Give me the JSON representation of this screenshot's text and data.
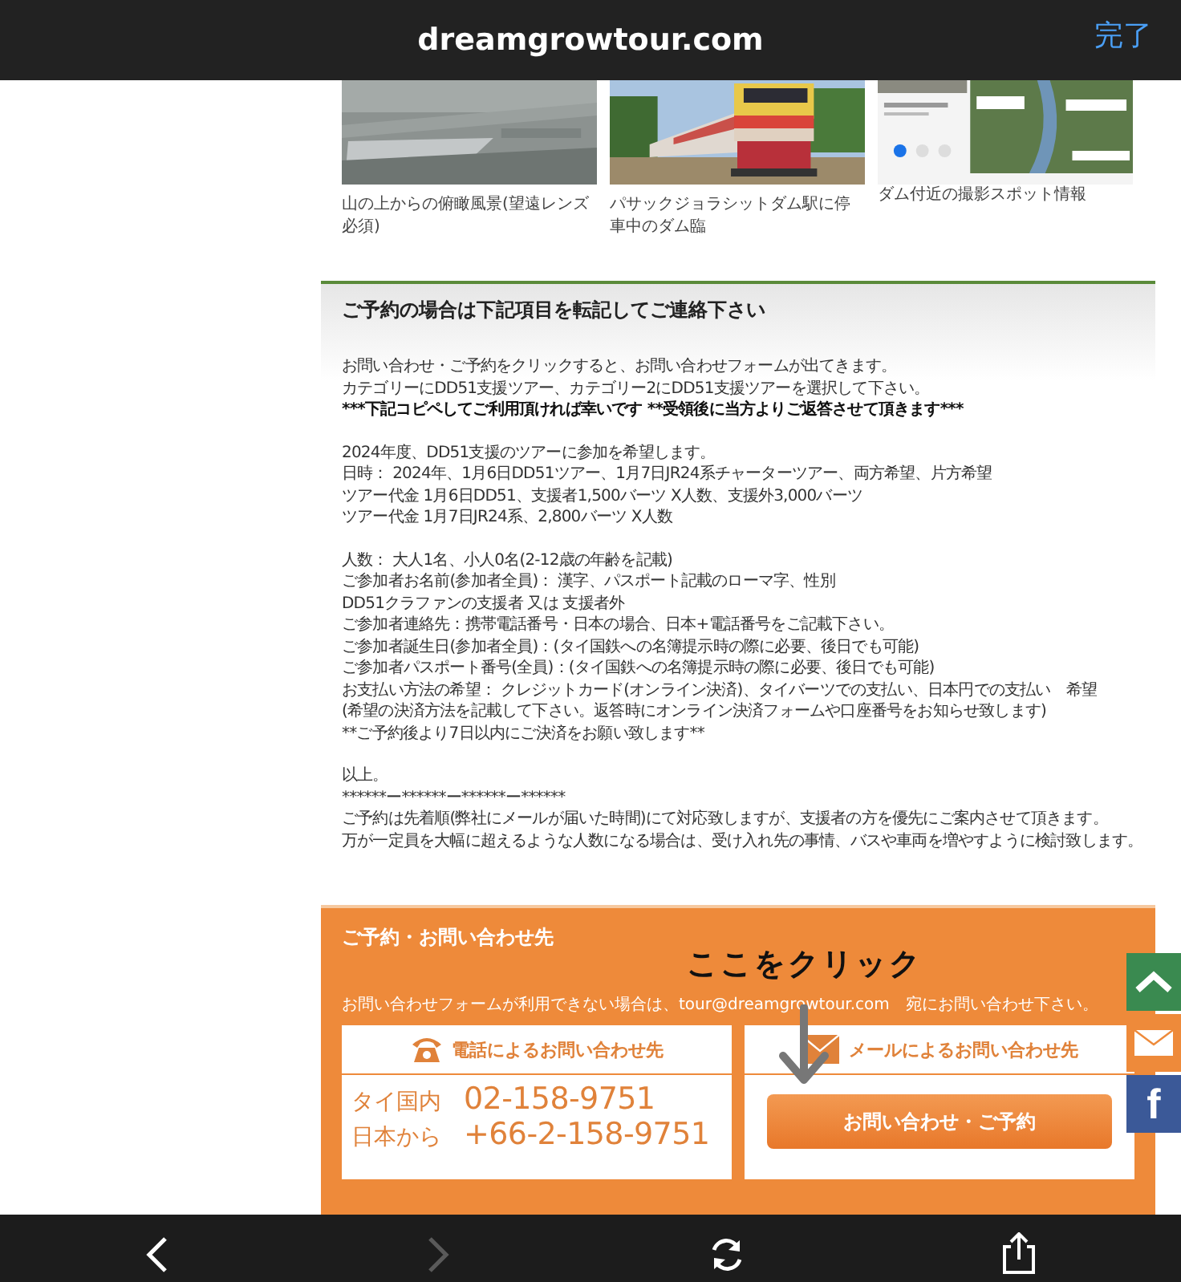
{
  "browser": {
    "title": "dreamgrowtour.com",
    "done": "完了"
  },
  "gallery": [
    {
      "caption": "山の上からの俯瞰風景(望遠レンズ必須)",
      "kind": "aerial"
    },
    {
      "caption": "パサックジョラシットダム駅に停車中のダム臨",
      "kind": "train"
    },
    {
      "caption": "ダム付近の撮影スポット情報",
      "kind": "map"
    }
  ],
  "notice": {
    "heading": "ご予約の場合は下記項目を転記してご連絡下さい",
    "blocks": [
      {
        "lines": [
          {
            "text": "お問い合わせ・ご予約をクリックすると、お問い合わせフォームが出てきます。",
            "bold": false
          },
          {
            "text": "カテゴリーにDD51支援ツアー、カテゴリー2にDD51支援ツアーを選択して下さい。",
            "bold": false
          },
          {
            "text": "***下記コピペしてご利用頂ければ幸いです  **受領後に当方よりご返答させて頂きます***",
            "bold": true
          }
        ]
      },
      {
        "lines": [
          {
            "text": "2024年度、DD51支援のツアーに参加を希望します。",
            "bold": false
          },
          {
            "text": "日時：  2024年、1月6日DD51ツアー、1月7日JR24系チャーターツアー、両方希望、片方希望",
            "bold": false
          },
          {
            "text": "ツアー代金  1月6日DD51、支援者1,500バーツ X人数、支援外3,000バーツ",
            "bold": false
          },
          {
            "text": "ツアー代金  1月7日JR24系、2,800バーツ X人数",
            "bold": false
          }
        ]
      },
      {
        "lines": [
          {
            "text": "人数：  大人1名、小人0名(2-12歳の年齢を記載)",
            "bold": false
          },
          {
            "text": "ご参加者お名前(参加者全員)：  漢字、パスポート記載のローマ字、性別",
            "bold": false
          },
          {
            "text": "DD51クラファンの支援者  又は  支援者外",
            "bold": false
          },
          {
            "text": "ご参加者連絡先：携帯電話番号・日本の場合、日本+電話番号をご記載下さい。",
            "bold": false
          },
          {
            "text": "ご参加者誕生日(参加者全員)：(タイ国鉄への名簿提示時の際に必要、後日でも可能)",
            "bold": false
          },
          {
            "text": "ご参加者パスポート番号(全員)：(タイ国鉄への名簿提示時の際に必要、後日でも可能)",
            "bold": false
          },
          {
            "text": "お支払い方法の希望：  クレジットカード(オンライン決済)、タイバーツでの支払い、日本円での支払い　希望",
            "bold": false
          },
          {
            "text": "(希望の決済方法を記載して下さい。返答時にオンライン決済フォームや口座番号をお知らせ致します)",
            "bold": false
          },
          {
            "text": "**ご予約後より7日以内にご決済をお願い致します**",
            "bold": false
          }
        ]
      },
      {
        "lines": [
          {
            "text": "以上。",
            "bold": false
          },
          {
            "text": "******ー******ー******ー******",
            "bold": false
          },
          {
            "text": "ご予約は先着順(弊社にメールが届いた時間)にて対応致しますが、支援者の方を優先にご案内させて頂きます。",
            "bold": false
          },
          {
            "text": "万が一定員を大幅に超えるような人数になる場合は、受け入れ先の事情、バスや車両を増やすように検討致します。",
            "bold": false
          }
        ]
      }
    ]
  },
  "contact": {
    "heading": "ご予約・お問い合わせ先",
    "note": "お問い合わせフォームが利用できない場合は、tour@dreamgrowtour.com　宛にお問い合わせ下さい。",
    "phone": {
      "title": "電話によるお問い合わせ先",
      "rows": [
        {
          "label": "タイ国内",
          "number": "02-158-9751"
        },
        {
          "label": "日本から",
          "number": "+66-2-158-9751"
        }
      ]
    },
    "mail": {
      "title": "メールによるお問い合わせ先",
      "button": "お問い合わせ・ご予約"
    },
    "callout": "ここをクリック"
  },
  "side_buttons": [
    {
      "kind": "top"
    },
    {
      "kind": "mail"
    },
    {
      "kind": "facebook",
      "label": "f"
    }
  ],
  "toolbar": [
    {
      "kind": "back",
      "disabled": false
    },
    {
      "kind": "forward",
      "disabled": true
    },
    {
      "kind": "reload",
      "disabled": false
    },
    {
      "kind": "share",
      "disabled": false
    }
  ]
}
